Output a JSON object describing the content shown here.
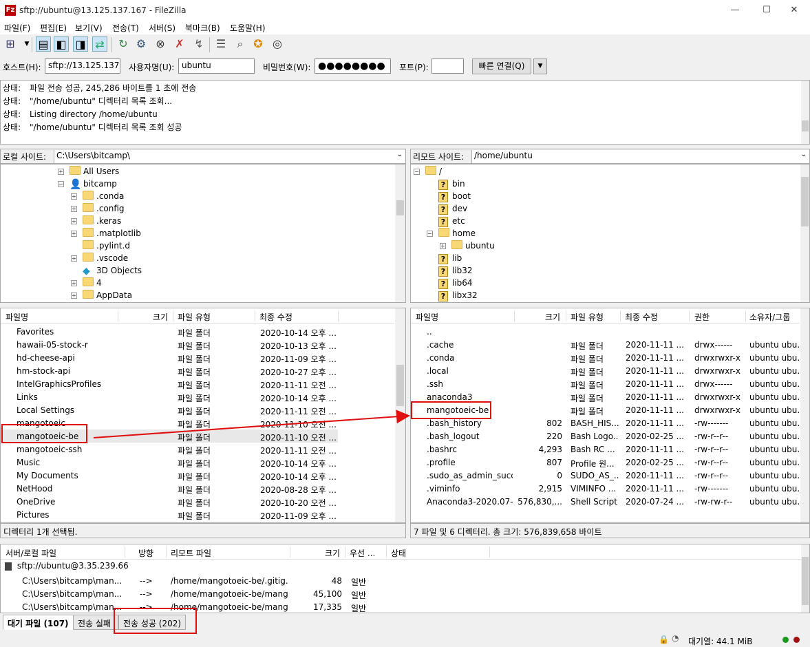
{
  "titlebar": {
    "title": "sftp://ubuntu@13.125.137.167 - FileZilla",
    "app_icon": "Fz",
    "minimize": "—",
    "maximize": "☐",
    "close": "✕"
  },
  "menu": [
    "파일(F)",
    "편집(E)",
    "보기(V)",
    "전송(T)",
    "서버(S)",
    "북마크(B)",
    "도움말(H)"
  ],
  "quickconnect": {
    "host_label": "호스트(H):",
    "host_value": "sftp://13.125.137.1",
    "user_label": "사용자명(U):",
    "user_value": "ubuntu",
    "password_label": "비밀번호(W):",
    "password_value": "●●●●●●●●",
    "port_label": "포트(P):",
    "port_value": "",
    "connect_button": "빠른 연결(Q)"
  },
  "log": [
    {
      "k": "상태:",
      "v": "파일 전송 성공, 245,286 바이트를 1 초에 전송"
    },
    {
      "k": "상태:",
      "v": "\"/home/ubuntu\" 디렉터리 목록 조회..."
    },
    {
      "k": "상태:",
      "v": "Listing directory /home/ubuntu"
    },
    {
      "k": "상태:",
      "v": "\"/home/ubuntu\" 디렉터리 목록 조회 성공"
    }
  ],
  "local": {
    "site_label": "로컬 사이트:",
    "path": "C:\\Users\\bitcamp\\",
    "tree": [
      {
        "label": "All Users",
        "depth": 0,
        "exp": "+",
        "icon": "folder"
      },
      {
        "label": "bitcamp",
        "depth": 0,
        "exp": "−",
        "icon": "user"
      },
      {
        "label": ".conda",
        "depth": 1,
        "exp": "+",
        "icon": "folder"
      },
      {
        "label": ".config",
        "depth": 1,
        "exp": "+",
        "icon": "folder"
      },
      {
        "label": ".keras",
        "depth": 1,
        "exp": "+",
        "icon": "folder"
      },
      {
        "label": ".matplotlib",
        "depth": 1,
        "exp": "+",
        "icon": "folder"
      },
      {
        "label": ".pylint.d",
        "depth": 1,
        "exp": "",
        "icon": "folder"
      },
      {
        "label": ".vscode",
        "depth": 1,
        "exp": "+",
        "icon": "folder"
      },
      {
        "label": "3D Objects",
        "depth": 1,
        "exp": "",
        "icon": "cube"
      },
      {
        "label": "4",
        "depth": 1,
        "exp": "+",
        "icon": "folder"
      },
      {
        "label": "AppData",
        "depth": 1,
        "exp": "+",
        "icon": "folder"
      }
    ],
    "headers": [
      "파일명",
      "크기",
      "파일 유형",
      "최종 수정"
    ],
    "files": [
      {
        "name": "Favorites",
        "size": "",
        "type": "파일 폴더",
        "modified": "2020-10-14 오후 ...",
        "icon": "star"
      },
      {
        "name": "hawaii-05-stock-r",
        "size": "",
        "type": "파일 폴더",
        "modified": "2020-10-13 오후 ...",
        "icon": "folder"
      },
      {
        "name": "hd-cheese-api",
        "size": "",
        "type": "파일 폴더",
        "modified": "2020-11-09 오후 ...",
        "icon": "folder"
      },
      {
        "name": "hm-stock-api",
        "size": "",
        "type": "파일 폴더",
        "modified": "2020-10-27 오후 ...",
        "icon": "folder"
      },
      {
        "name": "IntelGraphicsProfiles",
        "size": "",
        "type": "파일 폴더",
        "modified": "2020-11-11 오전 ...",
        "icon": "folder"
      },
      {
        "name": "Links",
        "size": "",
        "type": "파일 폴더",
        "modified": "2020-10-14 오후 ...",
        "icon": "link"
      },
      {
        "name": "Local Settings",
        "size": "",
        "type": "파일 폴더",
        "modified": "2020-11-11 오전 ...",
        "icon": "folder"
      },
      {
        "name": "mangotoeic",
        "size": "",
        "type": "파일 폴더",
        "modified": "2020-11-10 오전 ...",
        "icon": "folder"
      },
      {
        "name": "mangotoeic-be",
        "size": "",
        "type": "파일 폴더",
        "modified": "2020-11-10 오전 ...",
        "icon": "folder",
        "selected": true
      },
      {
        "name": "mangotoeic-ssh",
        "size": "",
        "type": "파일 폴더",
        "modified": "2020-11-11 오전 ...",
        "icon": "folder"
      },
      {
        "name": "Music",
        "size": "",
        "type": "파일 폴더",
        "modified": "2020-10-14 오후 ...",
        "icon": "music"
      },
      {
        "name": "My Documents",
        "size": "",
        "type": "파일 폴더",
        "modified": "2020-10-14 오후 ...",
        "icon": "docs"
      },
      {
        "name": "NetHood",
        "size": "",
        "type": "파일 폴더",
        "modified": "2020-08-28 오후 ...",
        "icon": "folder"
      },
      {
        "name": "OneDrive",
        "size": "",
        "type": "파일 폴더",
        "modified": "2020-10-20 오전 ...",
        "icon": "cloud"
      },
      {
        "name": "Pictures",
        "size": "",
        "type": "파일 폴더",
        "modified": "2020-11-09 오후 ...",
        "icon": "pic"
      }
    ],
    "status": "디렉터리 1개 선택됨."
  },
  "remote": {
    "site_label": "리모트 사이트:",
    "path": "/home/ubuntu",
    "tree": [
      {
        "label": "/",
        "depth": 0,
        "exp": "−",
        "icon": "folder"
      },
      {
        "label": "bin",
        "depth": 1,
        "exp": "",
        "icon": "q"
      },
      {
        "label": "boot",
        "depth": 1,
        "exp": "",
        "icon": "q"
      },
      {
        "label": "dev",
        "depth": 1,
        "exp": "",
        "icon": "q"
      },
      {
        "label": "etc",
        "depth": 1,
        "exp": "",
        "icon": "q"
      },
      {
        "label": "home",
        "depth": 1,
        "exp": "−",
        "icon": "folder"
      },
      {
        "label": "ubuntu",
        "depth": 2,
        "exp": "+",
        "icon": "folder"
      },
      {
        "label": "lib",
        "depth": 1,
        "exp": "",
        "icon": "q"
      },
      {
        "label": "lib32",
        "depth": 1,
        "exp": "",
        "icon": "q"
      },
      {
        "label": "lib64",
        "depth": 1,
        "exp": "",
        "icon": "q"
      },
      {
        "label": "libx32",
        "depth": 1,
        "exp": "",
        "icon": "q"
      }
    ],
    "headers": [
      "파일명",
      "크기",
      "파일 유형",
      "최종 수정",
      "권한",
      "소유자/그룹"
    ],
    "files": [
      {
        "name": "..",
        "size": "",
        "type": "",
        "modified": "",
        "perm": "",
        "owner": "",
        "icon": "folder"
      },
      {
        "name": ".cache",
        "size": "",
        "type": "파일 폴더",
        "modified": "2020-11-11 ...",
        "perm": "drwx------",
        "owner": "ubuntu ubu...",
        "icon": "folder"
      },
      {
        "name": ".conda",
        "size": "",
        "type": "파일 폴더",
        "modified": "2020-11-11 ...",
        "perm": "drwxrwxr-x",
        "owner": "ubuntu ubu...",
        "icon": "folder"
      },
      {
        "name": ".local",
        "size": "",
        "type": "파일 폴더",
        "modified": "2020-11-11 ...",
        "perm": "drwxrwxr-x",
        "owner": "ubuntu ubu...",
        "icon": "folder"
      },
      {
        "name": ".ssh",
        "size": "",
        "type": "파일 폴더",
        "modified": "2020-11-11 ...",
        "perm": "drwx------",
        "owner": "ubuntu ubu...",
        "icon": "folder"
      },
      {
        "name": "anaconda3",
        "size": "",
        "type": "파일 폴더",
        "modified": "2020-11-11 ...",
        "perm": "drwxrwxr-x",
        "owner": "ubuntu ubu...",
        "icon": "folder"
      },
      {
        "name": "mangotoeic-be",
        "size": "",
        "type": "파일 폴더",
        "modified": "2020-11-11 ...",
        "perm": "drwxrwxr-x",
        "owner": "ubuntu ubu...",
        "icon": "folder"
      },
      {
        "name": ".bash_history",
        "size": "802",
        "type": "BASH_HIS...",
        "modified": "2020-11-11 ...",
        "perm": "-rw-------",
        "owner": "ubuntu ubu...",
        "icon": "file"
      },
      {
        "name": ".bash_logout",
        "size": "220",
        "type": "Bash Logo...",
        "modified": "2020-02-25 ...",
        "perm": "-rw-r--r--",
        "owner": "ubuntu ubu...",
        "icon": "file"
      },
      {
        "name": ".bashrc",
        "size": "4,293",
        "type": "Bash RC ...",
        "modified": "2020-11-11 ...",
        "perm": "-rw-r--r--",
        "owner": "ubuntu ubu...",
        "icon": "file"
      },
      {
        "name": ".profile",
        "size": "807",
        "type": "Profile 원...",
        "modified": "2020-02-25 ...",
        "perm": "-rw-r--r--",
        "owner": "ubuntu ubu...",
        "icon": "file"
      },
      {
        "name": ".sudo_as_admin_succ...",
        "size": "0",
        "type": "SUDO_AS_...",
        "modified": "2020-11-11 ...",
        "perm": "-rw-r--r--",
        "owner": "ubuntu ubu...",
        "icon": "file"
      },
      {
        "name": ".viminfo",
        "size": "2,915",
        "type": "VIMINFO ...",
        "modified": "2020-11-11 ...",
        "perm": "-rw-------",
        "owner": "ubuntu ubu...",
        "icon": "file"
      },
      {
        "name": "Anaconda3-2020.07-...",
        "size": "576,830,...",
        "type": "Shell Script",
        "modified": "2020-07-24 ...",
        "perm": "-rw-rw-r--",
        "owner": "ubuntu ubu...",
        "icon": "script"
      }
    ],
    "status": "7 파일 및 6 디렉터리. 총 크기: 576,839,658 바이트"
  },
  "queue": {
    "headers": [
      "서버/로컬 파일",
      "방향",
      "리모트 파일",
      "크기",
      "우선 ...",
      "상태"
    ],
    "server": "sftp://ubuntu@3.35.239.66",
    "rows": [
      {
        "local": "C:\\Users\\bitcamp\\man...",
        "dir": "-->",
        "remote": "/home/mangotoeic-be/.gitig...",
        "size": "48",
        "priority": "일반"
      },
      {
        "local": "C:\\Users\\bitcamp\\man...",
        "dir": "-->",
        "remote": "/home/mangotoeic-be/mang...",
        "size": "45,100",
        "priority": "일반"
      },
      {
        "local": "C:\\Users\\bitcamp\\man...",
        "dir": "-->",
        "remote": "/home/mangotoeic-be/mang...",
        "size": "17,335",
        "priority": "일반"
      }
    ]
  },
  "tabs": [
    "대기 파일 (107)",
    "전송 실패",
    "전송 성공 (202)"
  ],
  "statusbar": {
    "queue": "대기열: 44.1 MiB"
  },
  "colors": {
    "annotation": "#e01010",
    "selection": "#e8e8e8",
    "folder": "#f8d775"
  }
}
